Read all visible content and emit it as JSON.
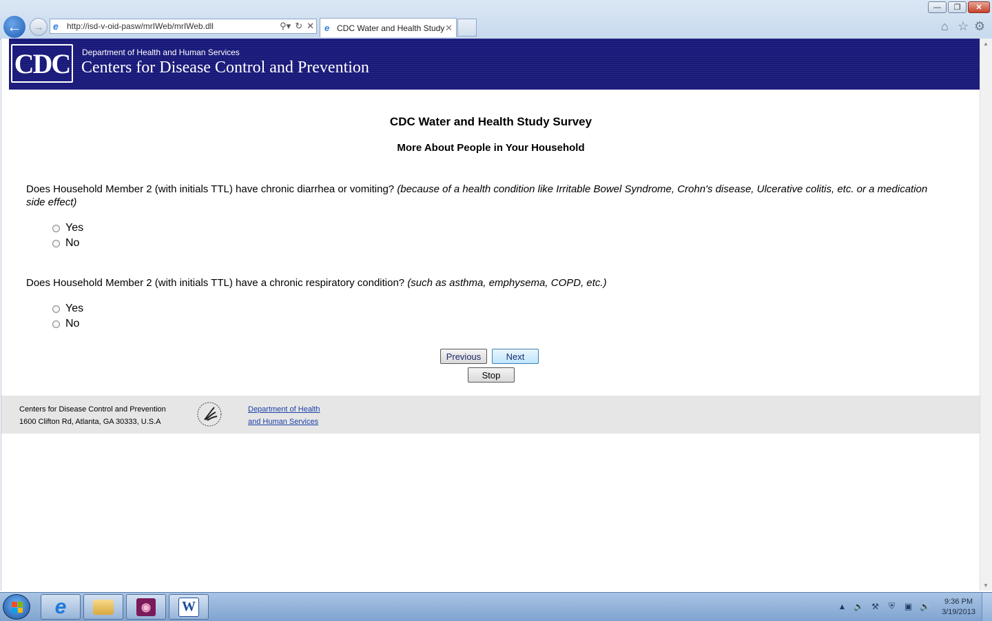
{
  "browser": {
    "url": "http://isd-v-oid-pasw/mrIWeb/mrIWeb.dll",
    "tab_title": "CDC Water and Health Study",
    "back_icon": "back-arrow-icon",
    "forward_icon": "forward-arrow-icon"
  },
  "banner": {
    "logo_text": "CDC",
    "dept": "Department of Health and Human Services",
    "agency": "Centers for Disease Control and Prevention"
  },
  "survey": {
    "title": "CDC Water and Health Study Survey",
    "section": "More About People in Your Household",
    "questions": [
      {
        "text": "Does Household Member 2 (with initials TTL) have chronic diarrhea or vomiting?",
        "note": "(because of a health condition like Irritable Bowel Syndrome, Crohn's disease, Ulcerative colitis, etc. or a medication side effect)",
        "options": [
          "Yes",
          "No"
        ]
      },
      {
        "text": "Does Household Member 2 (with initials TTL) have a chronic respiratory condition?",
        "note": "(such as asthma, emphysema, COPD, etc.)",
        "options": [
          "Yes",
          "No"
        ]
      }
    ],
    "buttons": {
      "previous": "Previous",
      "next": "Next",
      "stop": "Stop"
    }
  },
  "footer": {
    "org": "Centers for Disease Control and Prevention",
    "address": "1600 Clifton Rd, Atlanta, GA 30333, U.S.A",
    "link_line1": "Department of Health",
    "link_line2": "and Human Services"
  },
  "taskbar": {
    "time": "9:36 PM",
    "date": "3/19/2013"
  },
  "colors": {
    "banner": "#18187a",
    "footer_bg": "#e6e6e6",
    "link": "#1a3fa8"
  }
}
